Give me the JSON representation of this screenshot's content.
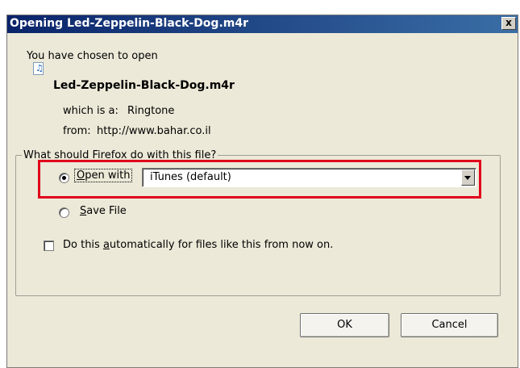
{
  "window": {
    "title": "Opening Led-Zeppelin-Black-Dog.m4r",
    "close_glyph": "x"
  },
  "intro": "You have chosen to open",
  "file": {
    "name": "Led-Zeppelin-Black-Dog.m4r",
    "icon": "music-file-icon",
    "type_label": "which is a:",
    "type_value": "Ringtone",
    "from_label": "from:",
    "from_value": "http://www.bahar.co.il"
  },
  "group": {
    "legend": "What should Firefox do with this file?",
    "open_with": {
      "label": "Open with",
      "accesskey": "O",
      "rest": "pen with",
      "selected": true
    },
    "app_select": {
      "value": "iTunes (default)"
    },
    "save_file": {
      "accesskey": "S",
      "rest": "ave File",
      "selected": false
    },
    "auto": {
      "pre": "Do this ",
      "accesskey": "a",
      "post": "utomatically for files like this from now on.",
      "checked": false
    }
  },
  "buttons": {
    "ok": "OK",
    "cancel": "Cancel"
  },
  "colors": {
    "highlight": "#e0001b",
    "title_start": "#0a246a",
    "title_end": "#3a6ea5",
    "dialog_bg": "#ece9d8"
  }
}
